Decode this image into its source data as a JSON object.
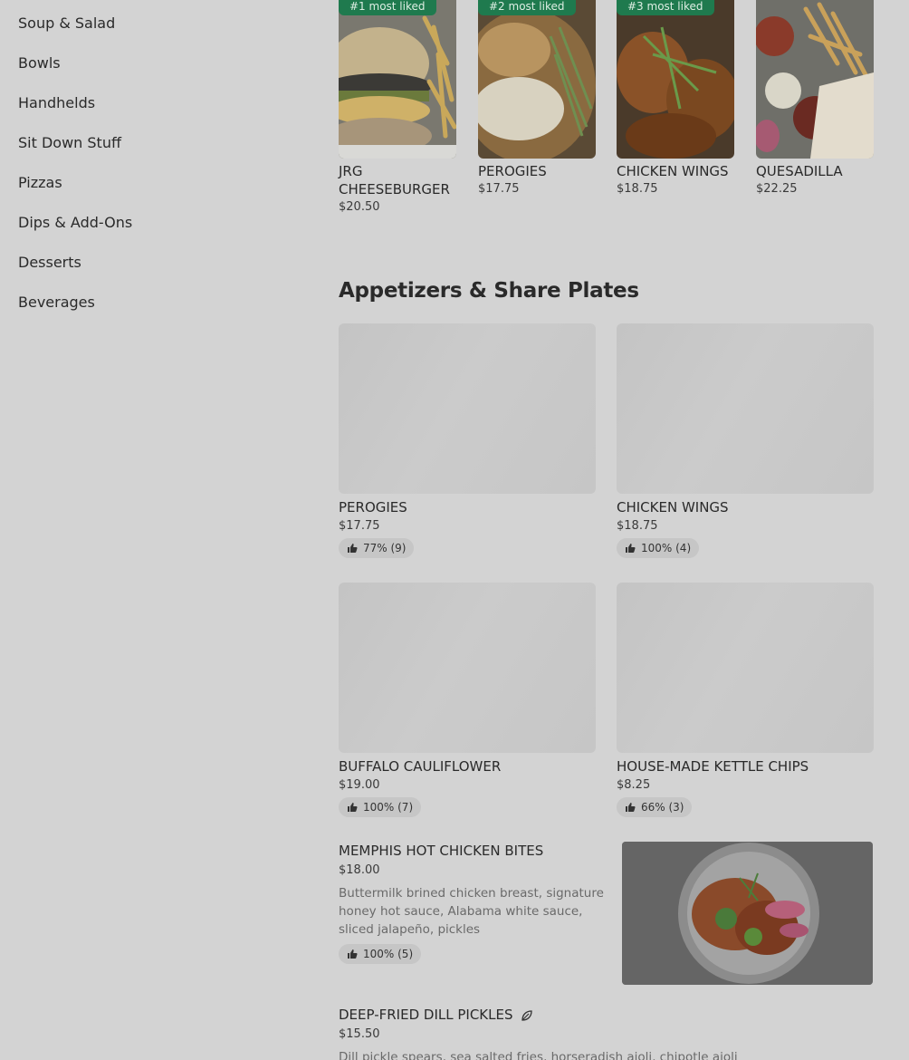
{
  "sidebar": {
    "items": [
      {
        "label": "Soup & Salad"
      },
      {
        "label": "Bowls"
      },
      {
        "label": "Handhelds"
      },
      {
        "label": "Sit Down Stuff"
      },
      {
        "label": "Pizzas"
      },
      {
        "label": "Dips & Add-Ons"
      },
      {
        "label": "Desserts"
      },
      {
        "label": "Beverages"
      }
    ]
  },
  "most_liked": [
    {
      "badge": "#1 most liked",
      "name": "JRG CHEESEBURGER",
      "price": "$20.50"
    },
    {
      "badge": "#2 most liked",
      "name": "PEROGIES",
      "price": "$17.75"
    },
    {
      "badge": "#3 most liked",
      "name": "CHICKEN WINGS",
      "price": "$18.75"
    },
    {
      "badge": "",
      "name": "QUESADILLA",
      "price": "$22.25"
    }
  ],
  "section": {
    "title": "Appetizers & Share Plates"
  },
  "grid_items": [
    {
      "name": "PEROGIES",
      "price": "$17.75",
      "rating": "77% (9)"
    },
    {
      "name": "CHICKEN WINGS",
      "price": "$18.75",
      "rating": "100% (4)"
    },
    {
      "name": "BUFFALO CAULIFLOWER",
      "price": "$19.00",
      "rating": "100% (7)"
    },
    {
      "name": "HOUSE-MADE KETTLE CHIPS",
      "price": "$8.25",
      "rating": "66% (3)"
    }
  ],
  "wide_items": [
    {
      "name": "MEMPHIS HOT CHICKEN BITES",
      "price": "$18.00",
      "description": "Buttermilk brined chicken breast, signature honey hot sauce, Alabama white sauce, sliced jalapeño, pickles",
      "rating": "100% (5)"
    },
    {
      "name": "DEEP-FRIED DILL PICKLES",
      "price": "$15.50",
      "description": "Dill pickle spears, sea salted fries, horseradish aioli, chipotle aioli"
    }
  ],
  "colors": {
    "badge": "#1f7a4e",
    "overlay_bg": "#d3d3d3"
  }
}
